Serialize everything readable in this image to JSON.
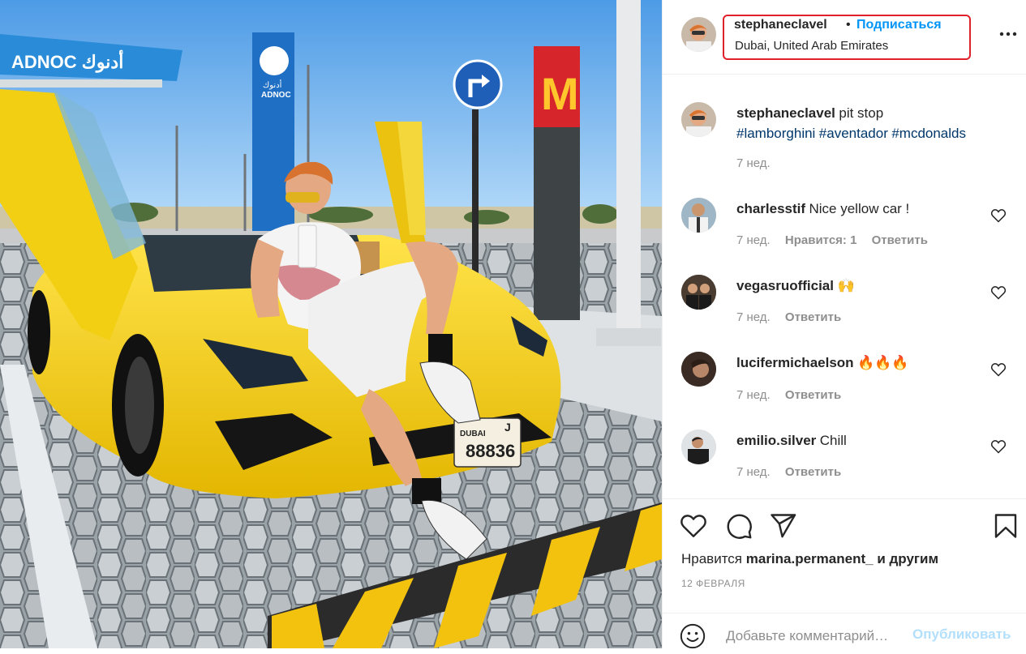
{
  "post": {
    "author": "stephaneclavel",
    "separator": "•",
    "follow_label": "Подписаться",
    "location": "Dubai, United Arab Emirates",
    "more_icon": "more-dots-icon"
  },
  "photo": {
    "station_sign": "ADNOC أدنوك",
    "pylon_arabic": "أدنوك",
    "pylon_brand": "ADNOC",
    "mcdonalds_logo": "M",
    "plate_city": "DUBAI",
    "plate_letter": "J",
    "plate_number": "88836",
    "colors": {
      "sky": "#6fb2ee",
      "car": "#f4d117",
      "adnoc_blue": "#1f6fc4",
      "mcd_red": "#d7262b",
      "mcd_yellow": "#ffc72c"
    }
  },
  "caption": {
    "user": "stephaneclavel",
    "text": "pit stop",
    "hashtags": [
      "#lamborghini",
      "#aventador",
      "#mcdonalds"
    ],
    "time": "7 нед."
  },
  "comments": [
    {
      "user": "charlesstif",
      "text": "Nice yellow car !",
      "time": "7 нед.",
      "likes": "Нравится: 1",
      "reply": "Ответить"
    },
    {
      "user": "vegasruofficial",
      "text": "🙌",
      "time": "7 нед.",
      "reply": "Ответить"
    },
    {
      "user": "lucifermichaelson",
      "text": "🔥🔥🔥",
      "time": "7 нед.",
      "reply": "Ответить"
    },
    {
      "user": "emilio.silver",
      "text": "Chill",
      "time": "7 нед.",
      "reply": "Ответить"
    }
  ],
  "actions": {
    "icons": [
      "heart-icon",
      "comment-icon",
      "share-icon",
      "bookmark-icon"
    ],
    "likes_prefix": "Нравится",
    "likes_user": "marina.permanent_",
    "likes_and": "и",
    "likes_others": "другим",
    "date": "12 ФЕВРАЛЯ"
  },
  "add_comment": {
    "placeholder": "Добавьте комментарий…",
    "publish_label": "Опубликовать"
  }
}
